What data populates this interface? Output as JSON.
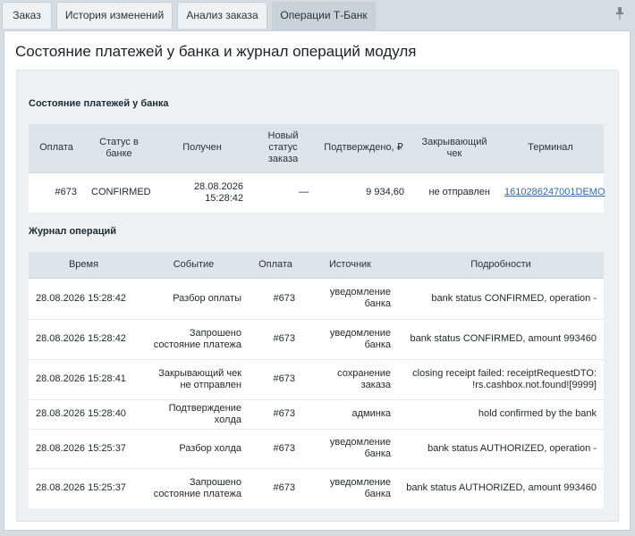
{
  "tabs": [
    {
      "label": "Заказ",
      "active": false
    },
    {
      "label": "История изменений",
      "active": false
    },
    {
      "label": "Анализ заказа",
      "active": false
    },
    {
      "label": "Операции Т-Банк",
      "active": true
    }
  ],
  "page_title": "Состояние платежей у банка и журнал операций модуля",
  "payments": {
    "section_title": "Состояние платежей у банка",
    "headers": [
      "Оплата",
      "Статус в банке",
      "Получен",
      "Новый статус заказа",
      "Подтверждено, ₽",
      "Закрывающий чек",
      "Терминал"
    ],
    "rows": [
      {
        "payment": "#673",
        "status": "CONFIRMED",
        "received": "28.08.2026 15:28:42",
        "new_status": "—",
        "confirmed": "9 934,60",
        "receipt": "не отправлен",
        "terminal": "1610286247001DEMO"
      }
    ]
  },
  "journal": {
    "section_title": "Журнал операций",
    "headers": [
      "Время",
      "Событие",
      "Оплата",
      "Источник",
      "Подробности"
    ],
    "rows": [
      {
        "time": "28.08.2026 15:28:42",
        "event": "Разбор оплаты",
        "payment": "#673",
        "source": "уведомление банка",
        "details": "bank status CONFIRMED, operation -"
      },
      {
        "time": "28.08.2026 15:28:42",
        "event": "Запрошено состояние платежа",
        "payment": "#673",
        "source": "уведомление банка",
        "details": "bank status CONFIRMED, amount 993460"
      },
      {
        "time": "28.08.2026 15:28:41",
        "event": "Закрывающий чек не отправлен",
        "payment": "#673",
        "source": "сохранение заказа",
        "details": "closing receipt failed: receiptRequestDTO: !rs.cashbox.not.found![9999]"
      },
      {
        "time": "28.08.2026 15:28:40",
        "event": "Подтверждение холда",
        "payment": "#673",
        "source": "админка",
        "details": "hold confirmed by the bank"
      },
      {
        "time": "28.08.2026 15:25:37",
        "event": "Разбор холда",
        "payment": "#673",
        "source": "уведомление банка",
        "details": "bank status AUTHORIZED, operation -"
      },
      {
        "time": "28.08.2026 15:25:37",
        "event": "Запрошено состояние платежа",
        "payment": "#673",
        "source": "уведомление банка",
        "details": "bank status AUTHORIZED, amount 993460"
      }
    ]
  },
  "icons": {
    "pin": "pin-icon"
  }
}
